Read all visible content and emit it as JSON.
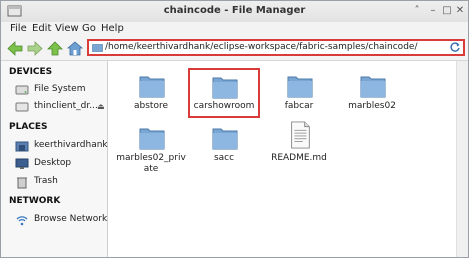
{
  "window": {
    "title": "chaincode - File Manager"
  },
  "menubar": {
    "items": [
      "File",
      "Edit",
      "View",
      "Go",
      "Help"
    ]
  },
  "location": {
    "path": "/home/keerthivardhank/eclipse-workspace/fabric-samples/chaincode/"
  },
  "sidebar": {
    "devices_header": "DEVICES",
    "devices": [
      "File System",
      "thinclient_dr..."
    ],
    "places_header": "PLACES",
    "places": [
      "keerthivardhank",
      "Desktop",
      "Trash"
    ],
    "network_header": "NETWORK",
    "network": [
      "Browse Network"
    ]
  },
  "files": [
    {
      "name": "abstore",
      "type": "folder"
    },
    {
      "name": "carshowroom",
      "type": "folder",
      "selected": true
    },
    {
      "name": "fabcar",
      "type": "folder"
    },
    {
      "name": "marbles02",
      "type": "folder"
    },
    {
      "name": "marbles02_private",
      "type": "folder"
    },
    {
      "name": "sacc",
      "type": "folder"
    },
    {
      "name": "README.md",
      "type": "text-file"
    }
  ],
  "colors": {
    "accent": "#d93a3a",
    "folder": "#7aa6d4"
  }
}
